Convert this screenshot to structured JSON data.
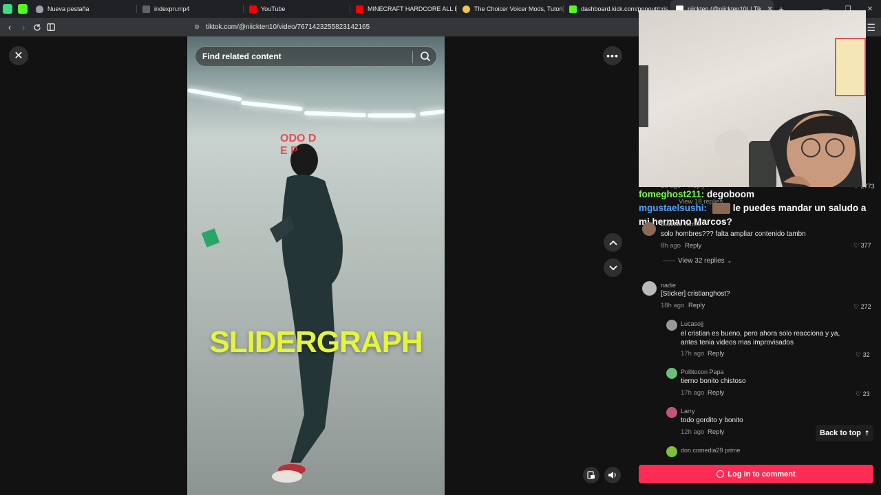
{
  "browser": {
    "tabs": [
      {
        "title": "Nueva pestaña",
        "color": "#9aa0a6"
      },
      {
        "title": "indexpn.mp4",
        "color": "#9aa0a6"
      },
      {
        "title": "YouTube",
        "color": "#ff0000"
      },
      {
        "title": "MINECRAFT HARDCORE ALL BOSS",
        "color": "#ff0000"
      },
      {
        "title": "The Choicer Voicer Mods, Tutorials",
        "color": "#f0c24a"
      },
      {
        "title": "dashboard.kick.com/popout/cris",
        "color": "#53fc18"
      },
      {
        "title": "niickten (@niickten10) | Tik",
        "color": "#ffffff"
      }
    ],
    "url": "tiktok.com/@niickten10/video/7671423255823142165"
  },
  "video": {
    "search_placeholder": "Find related content",
    "overlay_text": "SLIDERGRAPH",
    "overlay_red": "ODO D\nE P"
  },
  "stream_chat": [
    {
      "user": "fomeghost211",
      "user_color": "#7cfc4a",
      "message": "degoboom"
    },
    {
      "user": "mgustaelsushi",
      "user_color": "#4fa3ff",
      "message": "le puedes mandar un saludo a mi hermano Marcos?"
    }
  ],
  "comments": {
    "faded_time": "2d ago",
    "faded_reply": "Reply",
    "faded_likes": "2773",
    "faded_view": "View 18 replies",
    "top": [
      {
        "user": "Daniela Torres",
        "text": "solo hombres??? falta ampliar contenido tambn",
        "time": "8h ago",
        "reply": "Reply",
        "likes": "377",
        "view_replies": "View 32 replies"
      },
      {
        "user": "nadie",
        "text": "[Sticker] cristianghost?",
        "time": "18h ago",
        "reply": "Reply",
        "likes": "272"
      }
    ],
    "replies": [
      {
        "user": "Lucasojj",
        "text": "el cristian es bueno, pero ahora solo reacciona y ya, antes tenia videos mas improvisados",
        "time": "17h ago",
        "reply": "Reply",
        "likes": "32"
      },
      {
        "user": "Pollitocon Papa",
        "text": "tierno bonito chistoso",
        "time": "17h ago",
        "reply": "Reply",
        "likes": "23"
      },
      {
        "user": "Larry",
        "text": "todo gordito y bonito",
        "time": "12h ago",
        "reply": "Reply",
        "likes": ""
      },
      {
        "user": "don.comedia29 prime",
        "text": "",
        "time": "",
        "reply": "",
        "likes": ""
      }
    ],
    "back_to_top": "Back to top",
    "login_label": "Log in to comment"
  }
}
